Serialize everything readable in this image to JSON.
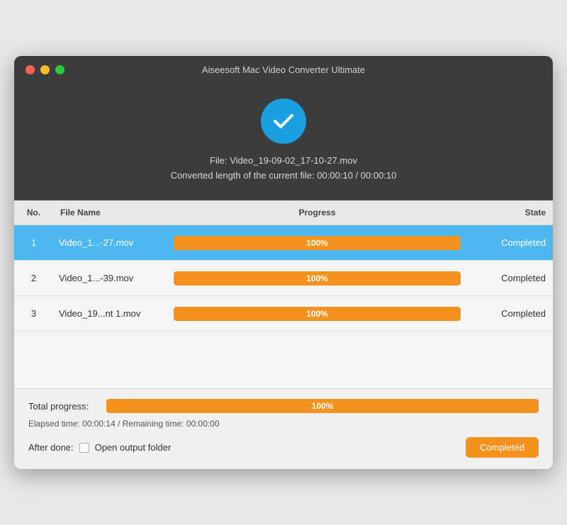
{
  "window": {
    "title": "Aiseesoft Mac Video Converter Ultimate"
  },
  "header": {
    "file_label": "File: Video_19-09-02_17-10-27.mov",
    "converted_label": "Converted length of the current file: 00:00:10 / 00:00:10"
  },
  "table": {
    "columns": {
      "no": "No.",
      "file_name": "File Name",
      "progress": "Progress",
      "state": "State"
    },
    "rows": [
      {
        "no": "1",
        "filename": "Video_1...-27.mov",
        "progress_pct": "100%",
        "state": "Completed",
        "selected": true
      },
      {
        "no": "2",
        "filename": "Video_1...-39.mov",
        "progress_pct": "100%",
        "state": "Completed",
        "selected": false
      },
      {
        "no": "3",
        "filename": "Video_19...nt 1.mov",
        "progress_pct": "100%",
        "state": "Completed",
        "selected": false
      }
    ]
  },
  "footer": {
    "total_progress_label": "Total progress:",
    "total_progress_pct": "100%",
    "elapsed_label": "Elapsed time: 00:00:14 / Remaining time: 00:00:00",
    "after_done_label": "After done:",
    "open_output_label": "Open output folder",
    "completed_button": "Completed"
  },
  "colors": {
    "progress_orange": "#f5921e",
    "selected_blue": "#4db8f0",
    "checkmark_blue": "#1a9fe0"
  }
}
